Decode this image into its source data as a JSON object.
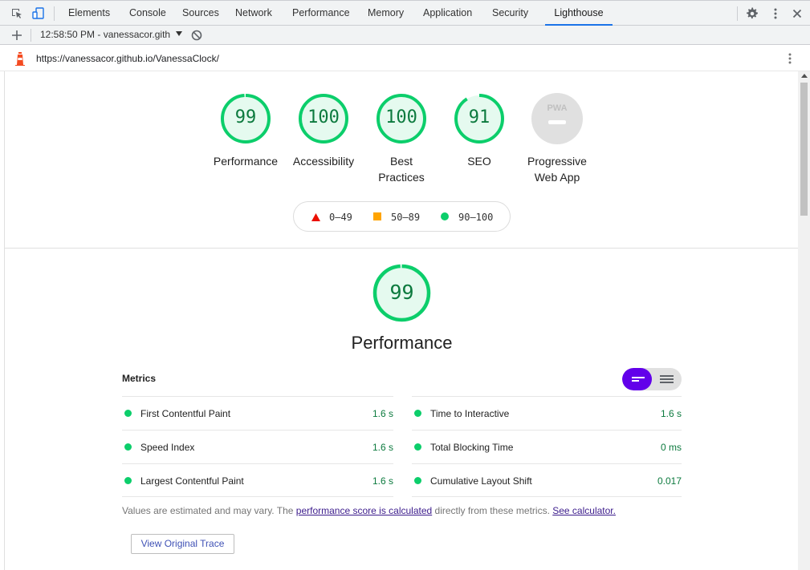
{
  "devtools": {
    "tabs": [
      "Elements",
      "Console",
      "Sources",
      "Network",
      "Performance",
      "Memory",
      "Application",
      "Security",
      "Lighthouse"
    ],
    "active_tab": "Lighthouse"
  },
  "toolbar": {
    "report_selector": "12:58:50 PM - vanessacor.gith"
  },
  "urlbar": {
    "url": "https://vanessacor.github.io/VanessaClock/"
  },
  "scores": [
    {
      "value": "99",
      "label": "Performance"
    },
    {
      "value": "100",
      "label": "Accessibility"
    },
    {
      "value": "100",
      "label_line1": "Best",
      "label_line2": "Practices"
    },
    {
      "value": "91",
      "label": "SEO"
    },
    {
      "label_line1": "Progressive",
      "label_line2": "Web App",
      "badge": "PWA"
    }
  ],
  "legend": {
    "fail": "0–49",
    "average": "50–89",
    "pass": "90–100"
  },
  "performance": {
    "score": "99",
    "title": "Performance",
    "metrics_heading": "Metrics",
    "metrics": [
      {
        "name": "First Contentful Paint",
        "value": "1.6 s"
      },
      {
        "name": "Time to Interactive",
        "value": "1.6 s"
      },
      {
        "name": "Speed Index",
        "value": "1.6 s"
      },
      {
        "name": "Total Blocking Time",
        "value": "0 ms"
      },
      {
        "name": "Largest Contentful Paint",
        "value": "1.6 s"
      },
      {
        "name": "Cumulative Layout Shift",
        "value": "0.017"
      }
    ],
    "note_prefix": "Values are estimated and may vary. The ",
    "note_link1": "performance score is calculated",
    "note_middle": " directly from these metrics. ",
    "note_link2": "See calculator.",
    "trace_button": "View Original Trace"
  },
  "colors": {
    "pass": "#0cce6b",
    "pass_text": "#0c7a3e",
    "average": "#ffa400",
    "fail": "#ff4e42",
    "toggle_accent": "#6200ea",
    "tab_underline": "#1a73e8"
  }
}
